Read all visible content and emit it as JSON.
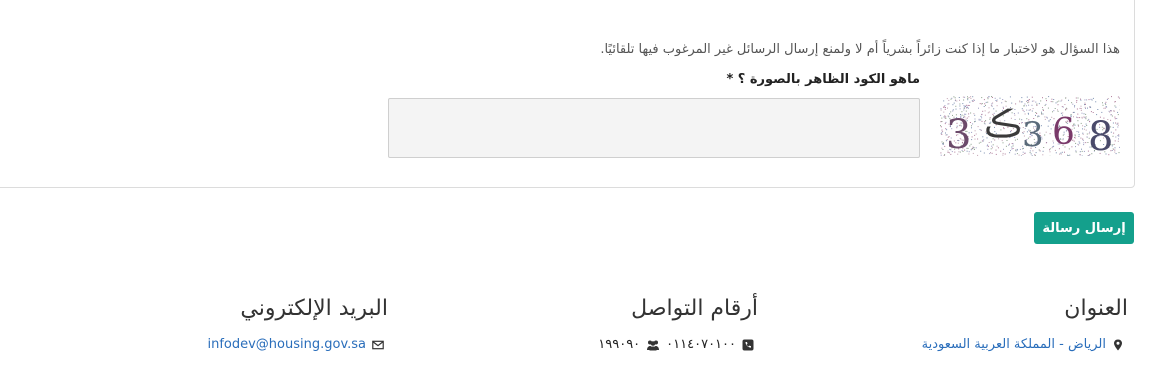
{
  "captcha": {
    "help_text": "هذا السؤال هو لاختبار ما إذا كنت زائراً بشرياً أم لا ولمنع إرسال الرسائل غير المرغوب فيها تلقائيًا.",
    "label": "ماهو الكود الظاهر بالصورة ؟ *",
    "image_text": "3 ڪ 3 6 8",
    "input_value": "",
    "input_placeholder": ""
  },
  "form": {
    "submit_label": "إرسال رسالة",
    "accent_color": "#14a08c"
  },
  "footer": {
    "address": {
      "heading": "العنوان",
      "icon": "map-marker-icon",
      "text": "الرياض - المملكة العربية السعودية"
    },
    "phones": {
      "heading": "أرقام التواصل",
      "phone_icon": "phone-icon",
      "phone": "٠١١٤٠٧٠١٠٠",
      "group_icon": "users-icon",
      "hotline": "١٩٩٠٩٠"
    },
    "email": {
      "heading": "البريد الإلكتروني",
      "icon": "envelope-icon",
      "text": "infodev@housing.gov.sa"
    }
  }
}
